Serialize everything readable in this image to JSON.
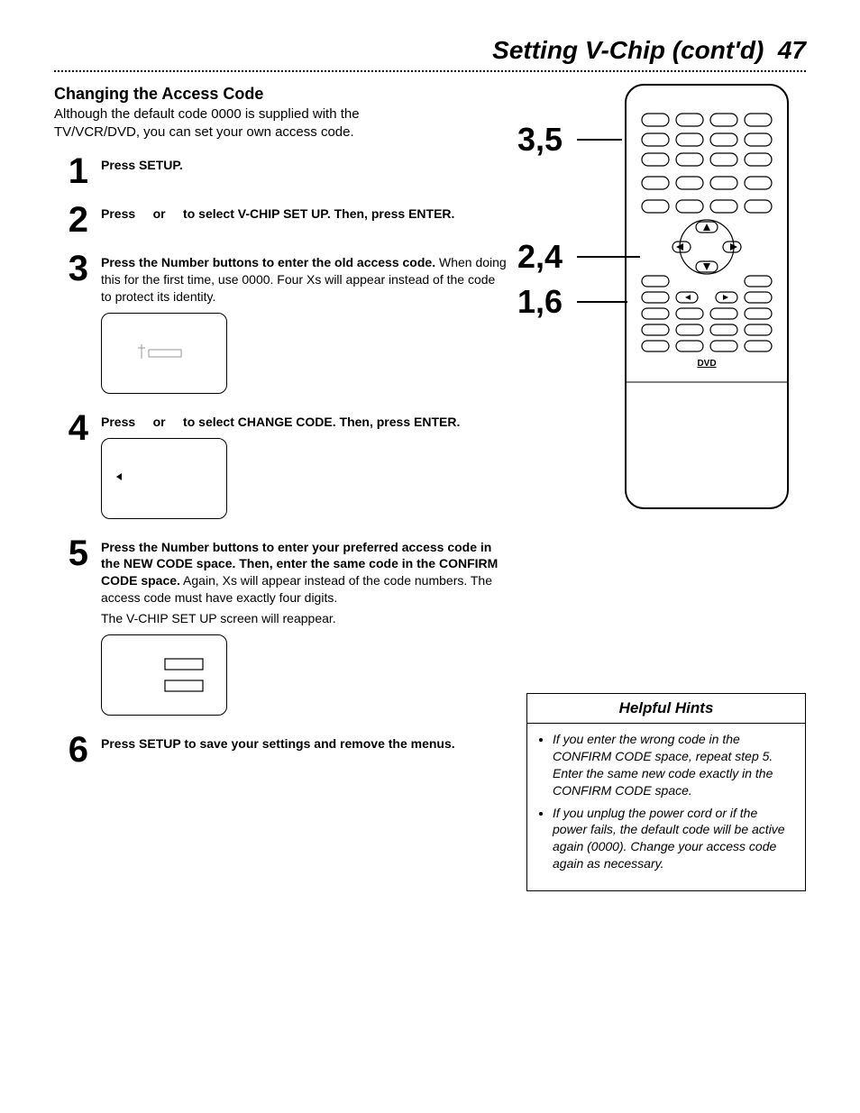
{
  "header": {
    "title": "Setting V-Chip (cont'd)",
    "page_number": "47"
  },
  "section": {
    "title": "Changing the Access Code",
    "intro": "Although the default code 0000 is supplied with the TV/VCR/DVD, you can set your own access code."
  },
  "steps": {
    "s1": {
      "num": "1",
      "b1": "Press SETUP."
    },
    "s2": {
      "num": "2",
      "b1": "Press ",
      "b2": " or ",
      "b3": " to select V-CHIP SET UP. Then, press ENTER."
    },
    "s3": {
      "num": "3",
      "b1": "Press the Number buttons to enter the old access code.",
      "t1": " When doing this for the first time, use 0000. Four Xs will appear instead of the code to protect its identity."
    },
    "s4": {
      "num": "4",
      "b1": "Press ",
      "b2": " or ",
      "b3": " to select CHANGE CODE. Then, press ENTER."
    },
    "s5": {
      "num": "5",
      "b1": "Press the Number buttons to enter your preferred access code in the NEW CODE space. Then, enter the same code in the CONFIRM CODE space.",
      "t1": " Again, Xs will appear instead of the code numbers. The access code must have exactly four digits.",
      "t2": "The V-CHIP SET UP screen will reappear."
    },
    "s6": {
      "num": "6",
      "b1": "Press SETUP to save your settings and remove the menus."
    }
  },
  "callouts": {
    "c35": "3,5",
    "c24": "2,4",
    "c16": "1,6"
  },
  "hints": {
    "title": "Helpful Hints",
    "h1": "If you enter the wrong code in the CONFIRM CODE space, repeat step 5. Enter the same new code exactly in the CONFIRM CODE space.",
    "h2": "If you unplug the power cord or if the power fails, the default code will be active again (0000). Change your access code again as necessary."
  },
  "remote": {
    "label": "DVD"
  }
}
